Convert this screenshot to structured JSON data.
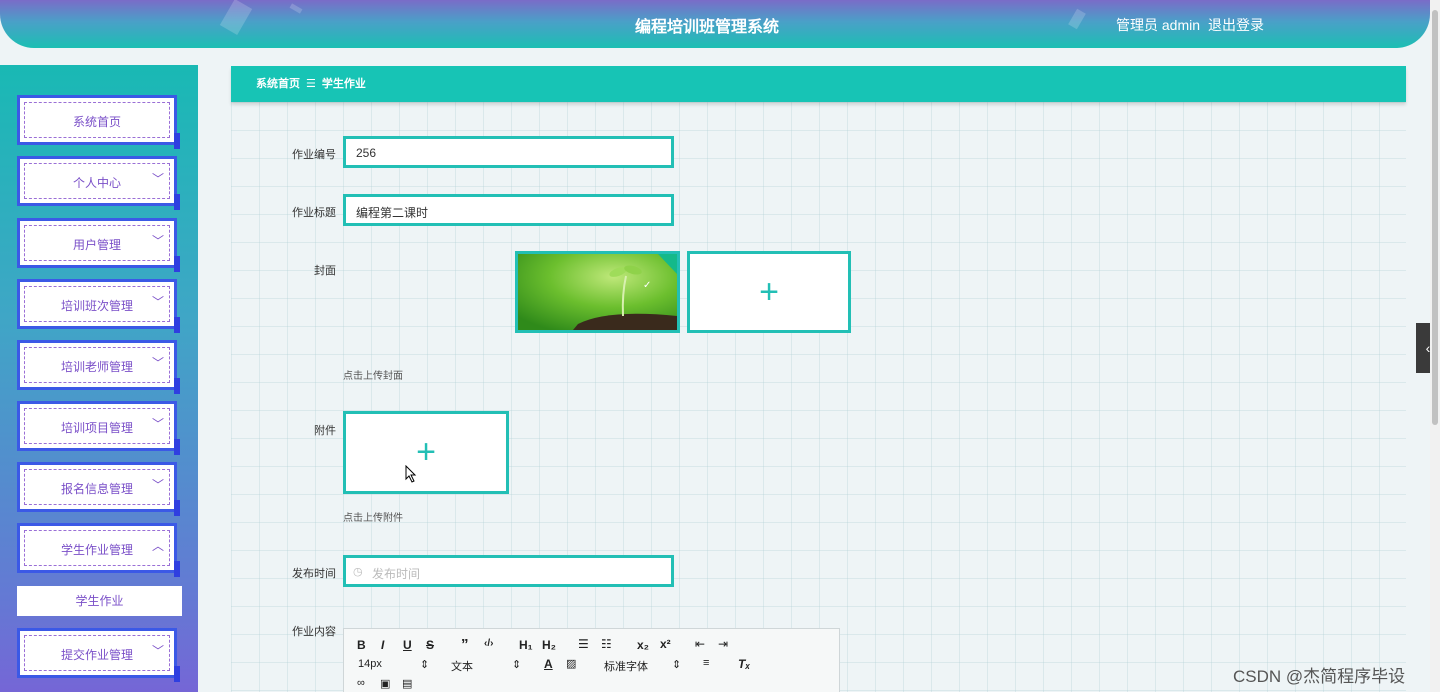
{
  "header": {
    "title": "编程培训班管理系统",
    "user": "管理员 admin",
    "logout": "退出登录"
  },
  "sidebar": {
    "items": [
      {
        "label": "系统首页"
      },
      {
        "label": "个人中心"
      },
      {
        "label": "用户管理"
      },
      {
        "label": "培训班次管理"
      },
      {
        "label": "培训老师管理"
      },
      {
        "label": "培训项目管理"
      },
      {
        "label": "报名信息管理"
      },
      {
        "label": "学生作业管理"
      },
      {
        "label": "提交作业管理"
      }
    ],
    "subitem": "学生作业",
    "chevron_down": "﹀",
    "chevron_up": "︿"
  },
  "breadcrumb": {
    "home": "系统首页",
    "separator": "☰",
    "current": "学生作业"
  },
  "form": {
    "no_label": "作业编号",
    "no_value": "256",
    "title_label": "作业标题",
    "title_value": "编程第二课时",
    "cover_label": "封面",
    "cover_hint": "点击上传封面",
    "attachment_label": "附件",
    "attachment_hint": "点击上传附件",
    "time_label": "发布时间",
    "time_placeholder": "发布时间",
    "content_label": "作业内容",
    "plus": "+"
  },
  "editor": {
    "font_size": "14px",
    "paragraph": "文本",
    "font_family": "标准字体"
  },
  "watermark": "CSDN @杰简程序毕设",
  "colors": {
    "accent": "#17c4b5",
    "menu_border": "#3b59e6",
    "menu_text": "#7a4fc8"
  }
}
